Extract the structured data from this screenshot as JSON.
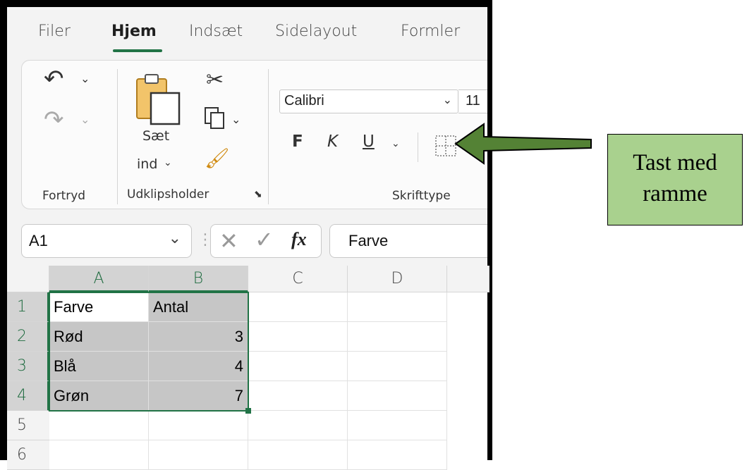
{
  "tabs": [
    "Filer",
    "Hjem",
    "Indsæt",
    "Sidelayout",
    "Formler"
  ],
  "active_tab": "Hjem",
  "ribbon": {
    "groups": {
      "undo": "Fortryd",
      "clipboard": "Udklipsholder",
      "font": "Skrifttype"
    },
    "paste_label_line1": "Sæt",
    "paste_label_line2": "ind",
    "font_name": "Calibri",
    "font_size": "11",
    "bold": "F",
    "italic": "K",
    "underline": "U"
  },
  "formula_bar": {
    "name_box": "A1",
    "fx": "fx",
    "formula": "Farve"
  },
  "sheet": {
    "columns": [
      "A",
      "B",
      "C",
      "D"
    ],
    "rows": [
      "1",
      "2",
      "3",
      "4",
      "5",
      "6"
    ],
    "cells": [
      [
        "Farve",
        "Antal"
      ],
      [
        "Rød",
        "3"
      ],
      [
        "Blå",
        "4"
      ],
      [
        "Grøn",
        "7"
      ]
    ]
  },
  "callout": {
    "line1": "Tast med",
    "line2": "ramme"
  },
  "colors": {
    "accent": "#217346",
    "callout_fill": "#a9d18e",
    "arrow": "#548235",
    "selection_fill": "#c6c6c6"
  }
}
